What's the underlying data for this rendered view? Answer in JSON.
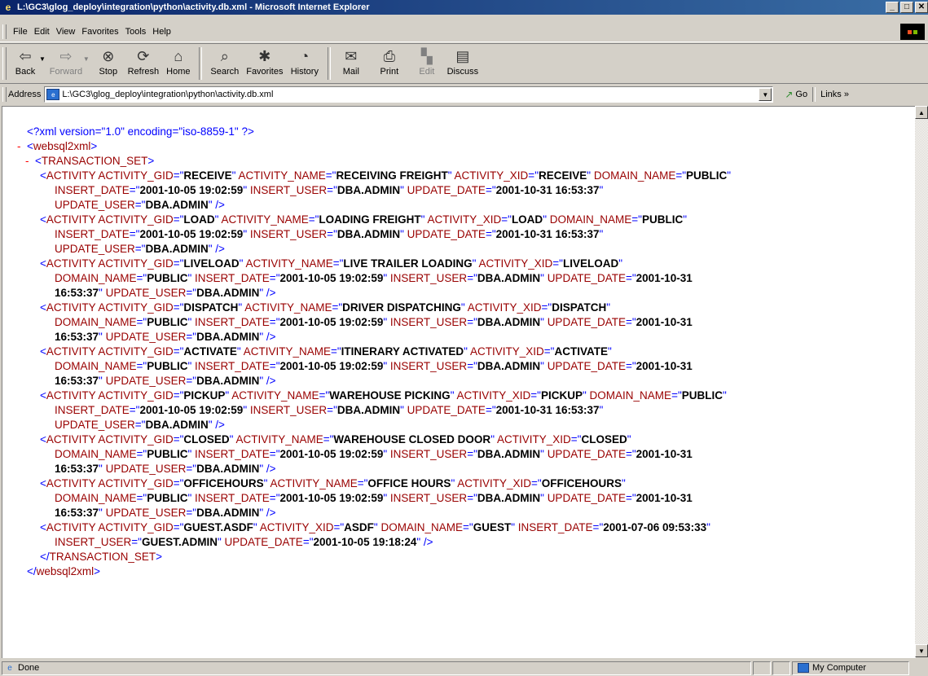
{
  "window": {
    "title": "L:\\GC3\\glog_deploy\\integration\\python\\activity.db.xml - Microsoft Internet Explorer",
    "controls": [
      "minimize",
      "maximize",
      "close"
    ]
  },
  "menubar": {
    "items": [
      "File",
      "Edit",
      "View",
      "Favorites",
      "Tools",
      "Help"
    ]
  },
  "toolbar": {
    "back": "Back",
    "forward": "Forward",
    "stop": "Stop",
    "refresh": "Refresh",
    "home": "Home",
    "search": "Search",
    "favorites": "Favorites",
    "history": "History",
    "mail": "Mail",
    "print": "Print",
    "edit": "Edit",
    "discuss": "Discuss"
  },
  "addressbar": {
    "label": "Address",
    "value": "L:\\GC3\\glog_deploy\\integration\\python\\activity.db.xml",
    "go": "Go",
    "links": "Links"
  },
  "xml": {
    "pi": "<?xml version=\"1.0\" encoding=\"iso-8859-1\" ?>",
    "root_open": "websql2xml",
    "set_open": "TRANSACTION_SET",
    "set_close": "TRANSACTION_SET",
    "root_close": "websql2xml",
    "element": "ACTIVITY",
    "records": [
      [
        [
          [
            "ACTIVITY_GID",
            "RECEIVE"
          ],
          [
            "ACTIVITY_NAME",
            "RECEIVING FREIGHT"
          ],
          [
            "ACTIVITY_XID",
            "RECEIVE"
          ],
          [
            "DOMAIN_NAME",
            "PUBLIC"
          ]
        ],
        [
          [
            "INSERT_DATE",
            "2001-10-05 19:02:59"
          ],
          [
            "INSERT_USER",
            "DBA.ADMIN"
          ],
          [
            "UPDATE_DATE",
            "2001-10-31 16:53:37"
          ]
        ],
        [
          [
            "UPDATE_USER",
            "DBA.ADMIN"
          ]
        ]
      ],
      [
        [
          [
            "ACTIVITY_GID",
            "LOAD"
          ],
          [
            "ACTIVITY_NAME",
            "LOADING FREIGHT"
          ],
          [
            "ACTIVITY_XID",
            "LOAD"
          ],
          [
            "DOMAIN_NAME",
            "PUBLIC"
          ]
        ],
        [
          [
            "INSERT_DATE",
            "2001-10-05 19:02:59"
          ],
          [
            "INSERT_USER",
            "DBA.ADMIN"
          ],
          [
            "UPDATE_DATE",
            "2001-10-31 16:53:37"
          ]
        ],
        [
          [
            "UPDATE_USER",
            "DBA.ADMIN"
          ]
        ]
      ],
      [
        [
          [
            "ACTIVITY_GID",
            "LIVELOAD"
          ],
          [
            "ACTIVITY_NAME",
            "LIVE TRAILER LOADING"
          ],
          [
            "ACTIVITY_XID",
            "LIVELOAD"
          ]
        ],
        [
          [
            "DOMAIN_NAME",
            "PUBLIC"
          ],
          [
            "INSERT_DATE",
            "2001-10-05 19:02:59"
          ],
          [
            "INSERT_USER",
            "DBA.ADMIN"
          ],
          [
            "UPDATE_DATE",
            "2001-10-31",
            "open"
          ]
        ],
        [
          [
            "",
            "16:53:37",
            "close"
          ],
          [
            "UPDATE_USER",
            "DBA.ADMIN"
          ]
        ]
      ],
      [
        [
          [
            "ACTIVITY_GID",
            "DISPATCH"
          ],
          [
            "ACTIVITY_NAME",
            "DRIVER DISPATCHING"
          ],
          [
            "ACTIVITY_XID",
            "DISPATCH"
          ]
        ],
        [
          [
            "DOMAIN_NAME",
            "PUBLIC"
          ],
          [
            "INSERT_DATE",
            "2001-10-05 19:02:59"
          ],
          [
            "INSERT_USER",
            "DBA.ADMIN"
          ],
          [
            "UPDATE_DATE",
            "2001-10-31",
            "open"
          ]
        ],
        [
          [
            "",
            "16:53:37",
            "close"
          ],
          [
            "UPDATE_USER",
            "DBA.ADMIN"
          ]
        ]
      ],
      [
        [
          [
            "ACTIVITY_GID",
            "ACTIVATE"
          ],
          [
            "ACTIVITY_NAME",
            "ITINERARY ACTIVATED"
          ],
          [
            "ACTIVITY_XID",
            "ACTIVATE"
          ]
        ],
        [
          [
            "DOMAIN_NAME",
            "PUBLIC"
          ],
          [
            "INSERT_DATE",
            "2001-10-05 19:02:59"
          ],
          [
            "INSERT_USER",
            "DBA.ADMIN"
          ],
          [
            "UPDATE_DATE",
            "2001-10-31",
            "open"
          ]
        ],
        [
          [
            "",
            "16:53:37",
            "close"
          ],
          [
            "UPDATE_USER",
            "DBA.ADMIN"
          ]
        ]
      ],
      [
        [
          [
            "ACTIVITY_GID",
            "PICKUP"
          ],
          [
            "ACTIVITY_NAME",
            "WAREHOUSE PICKING"
          ],
          [
            "ACTIVITY_XID",
            "PICKUP"
          ],
          [
            "DOMAIN_NAME",
            "PUBLIC"
          ]
        ],
        [
          [
            "INSERT_DATE",
            "2001-10-05 19:02:59"
          ],
          [
            "INSERT_USER",
            "DBA.ADMIN"
          ],
          [
            "UPDATE_DATE",
            "2001-10-31 16:53:37"
          ]
        ],
        [
          [
            "UPDATE_USER",
            "DBA.ADMIN"
          ]
        ]
      ],
      [
        [
          [
            "ACTIVITY_GID",
            "CLOSED"
          ],
          [
            "ACTIVITY_NAME",
            "WAREHOUSE CLOSED DOOR"
          ],
          [
            "ACTIVITY_XID",
            "CLOSED"
          ]
        ],
        [
          [
            "DOMAIN_NAME",
            "PUBLIC"
          ],
          [
            "INSERT_DATE",
            "2001-10-05 19:02:59"
          ],
          [
            "INSERT_USER",
            "DBA.ADMIN"
          ],
          [
            "UPDATE_DATE",
            "2001-10-31",
            "open"
          ]
        ],
        [
          [
            "",
            "16:53:37",
            "close"
          ],
          [
            "UPDATE_USER",
            "DBA.ADMIN"
          ]
        ]
      ],
      [
        [
          [
            "ACTIVITY_GID",
            "OFFICEHOURS"
          ],
          [
            "ACTIVITY_NAME",
            "OFFICE HOURS"
          ],
          [
            "ACTIVITY_XID",
            "OFFICEHOURS"
          ]
        ],
        [
          [
            "DOMAIN_NAME",
            "PUBLIC"
          ],
          [
            "INSERT_DATE",
            "2001-10-05 19:02:59"
          ],
          [
            "INSERT_USER",
            "DBA.ADMIN"
          ],
          [
            "UPDATE_DATE",
            "2001-10-31",
            "open"
          ]
        ],
        [
          [
            "",
            "16:53:37",
            "close"
          ],
          [
            "UPDATE_USER",
            "DBA.ADMIN"
          ]
        ]
      ],
      [
        [
          [
            "ACTIVITY_GID",
            "GUEST.ASDF"
          ],
          [
            "ACTIVITY_XID",
            "ASDF"
          ],
          [
            "DOMAIN_NAME",
            "GUEST"
          ],
          [
            "INSERT_DATE",
            "2001-07-06 09:53:33"
          ]
        ],
        [
          [
            "INSERT_USER",
            "GUEST.ADMIN"
          ],
          [
            "UPDATE_DATE",
            "2001-10-05 19:18:24"
          ]
        ]
      ]
    ]
  },
  "statusbar": {
    "text": "Done",
    "zone": "My Computer"
  },
  "colors": {
    "title_start": "#0a246a",
    "title_end": "#3a6ea5",
    "xml_markup": "#0000ff",
    "xml_name": "#990000",
    "xml_minus": "#ff0000"
  }
}
